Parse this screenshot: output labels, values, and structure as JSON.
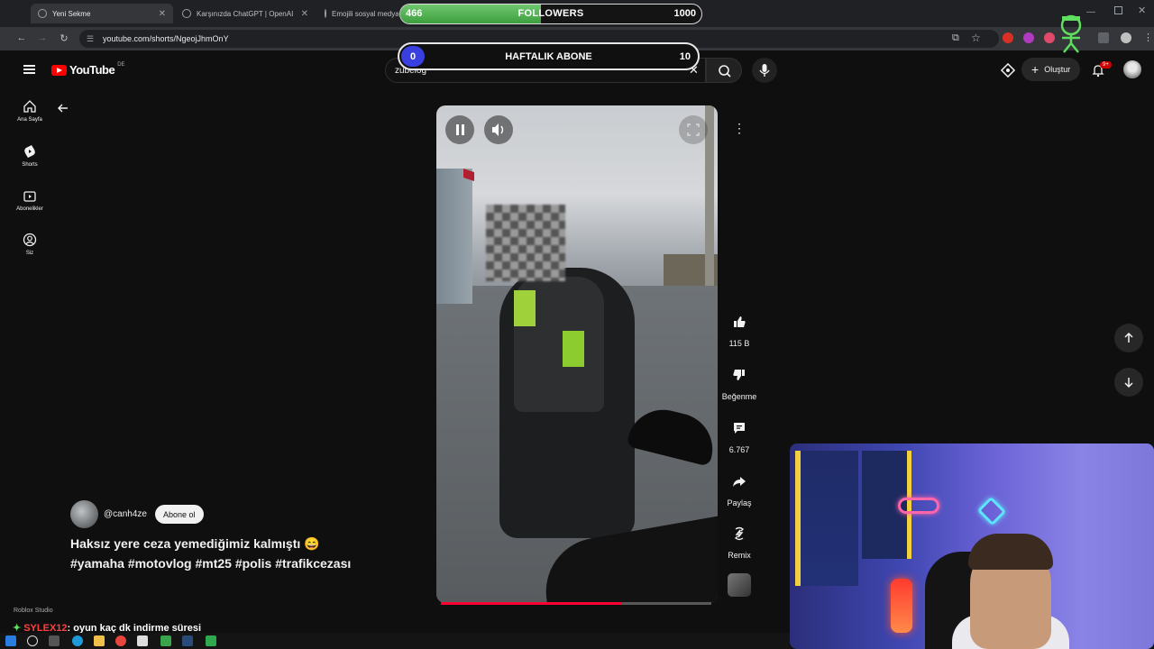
{
  "browser": {
    "tabs": [
      {
        "title": "Yeni Sekme",
        "active": true
      },
      {
        "title": "Karşınızda ChatGPT | OpenAI",
        "active": false
      },
      {
        "title": "Emojili sosyal medya",
        "active": false
      }
    ],
    "url": "youtube.com/shorts/NgeojJhmOnY"
  },
  "overlay": {
    "followers": {
      "current": "466",
      "label": "FOLLOWERS",
      "target": "1000",
      "progress": 0.466
    },
    "weekly": {
      "current": "0",
      "label": "HAFTALIK ABONE",
      "target": "10",
      "progress": 0.0
    }
  },
  "youtube": {
    "logo_text": "YouTube",
    "logo_region": "DE",
    "search_value": "zubelog",
    "create_label": "Oluştur",
    "notif_count": "9+",
    "nav": [
      {
        "label": "Ana Sayfa",
        "icon": "home-icon"
      },
      {
        "label": "Shorts",
        "icon": "shorts-icon"
      },
      {
        "label": "Abonelikler",
        "icon": "subscriptions-icon"
      },
      {
        "label": "Siz",
        "icon": "you-icon"
      }
    ]
  },
  "short": {
    "channel": "@canh4ze",
    "subscribe_label": "Abone ol",
    "caption": "Haksız yere ceza yemediğimiz kalmıştı 😄 #yamaha #motovlog #mt25 #polis #trafikcezası",
    "progress": 0.67,
    "actions": {
      "like_count": "115 B",
      "dislike_label": "Beğenme",
      "comment_count": "6.767",
      "share_label": "Paylaş",
      "remix_label": "Remix"
    }
  },
  "stream": {
    "roblox_label": "Roblox Studio",
    "chat_user": "SYLEX12",
    "chat_message": ": oyun kaç dk indirme süresi"
  },
  "colors": {
    "yt_red": "#ff0000",
    "follower_green": "#4cae4c",
    "weekly_blue": "#3a3fe0",
    "progress_red": "#ff0033"
  }
}
